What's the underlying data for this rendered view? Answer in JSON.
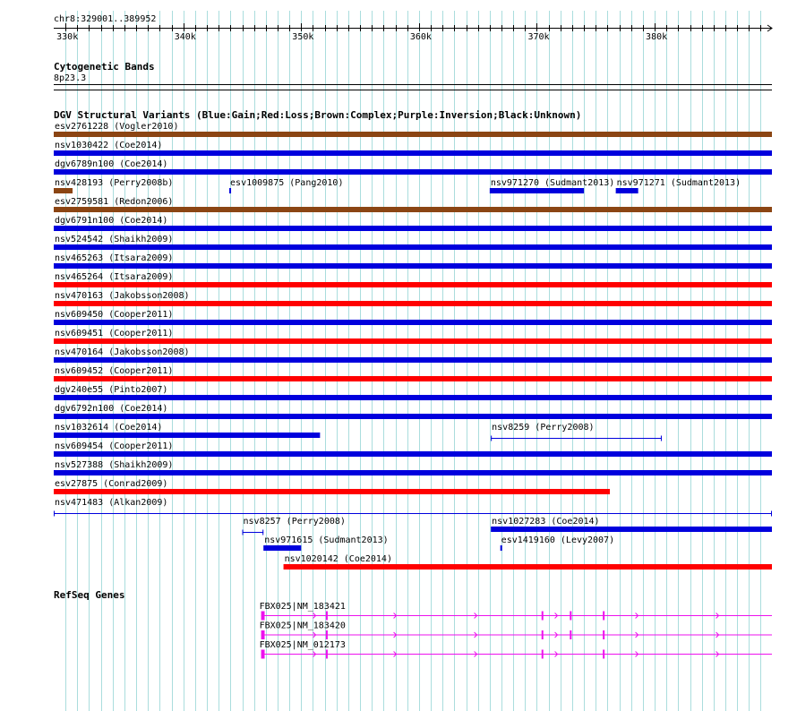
{
  "region": "chr8:329001..389952",
  "axis": {
    "ticks": [
      {
        "pos": 330000,
        "label": "330k"
      },
      {
        "pos": 340000,
        "label": "340k"
      },
      {
        "pos": 350000,
        "label": "350k"
      },
      {
        "pos": 360000,
        "label": "360k"
      },
      {
        "pos": 370000,
        "label": "370k"
      },
      {
        "pos": 380000,
        "label": "380k"
      }
    ],
    "start": 329001,
    "end": 389952
  },
  "colors": {
    "gain": "#0000dd",
    "loss": "#ff0000",
    "complex": "#8b4513",
    "gene": "#ee11ee",
    "grid": "#aadddd"
  },
  "tracks": {
    "cytoband": {
      "title": "Cytogenetic Bands",
      "band": "8p23.3"
    },
    "dgv": {
      "title": "DGV Structural Variants (Blue:Gain;Red:Loss;Brown:Complex;Purple:Inversion;Black:Unknown)",
      "rows": [
        [
          {
            "label": "esv2761228 (Vogler2010)",
            "start": 329001,
            "end": 389952,
            "type": "complex"
          }
        ],
        [
          {
            "label": "nsv1030422 (Coe2014)",
            "start": 329001,
            "end": 389952,
            "type": "gain"
          }
        ],
        [
          {
            "label": "dgv6789n100 (Coe2014)",
            "start": 329001,
            "end": 389952,
            "type": "gain"
          }
        ],
        [
          {
            "label": "nsv428193 (Perry2008b)",
            "start": 329001,
            "end": 330600,
            "type": "complex"
          },
          {
            "label": "esv1009875 (Pang2010)",
            "start": 343900,
            "end": 344000,
            "type": "gain"
          },
          {
            "label": "nsv971270 (Sudmant2013)",
            "start": 366000,
            "end": 374000,
            "type": "gain"
          },
          {
            "label": "nsv971271 (Sudmant2013)",
            "start": 376700,
            "end": 378600,
            "type": "gain"
          }
        ],
        [
          {
            "label": "esv2759581 (Redon2006)",
            "start": 329001,
            "end": 389952,
            "type": "complex"
          }
        ],
        [
          {
            "label": "dgv6791n100 (Coe2014)",
            "start": 329001,
            "end": 389952,
            "type": "gain"
          }
        ],
        [
          {
            "label": "nsv524542 (Shaikh2009)",
            "start": 329001,
            "end": 389952,
            "type": "gain"
          }
        ],
        [
          {
            "label": "nsv465263 (Itsara2009)",
            "start": 329001,
            "end": 389952,
            "type": "gain"
          }
        ],
        [
          {
            "label": "nsv465264 (Itsara2009)",
            "start": 329001,
            "end": 389952,
            "type": "loss"
          }
        ],
        [
          {
            "label": "nsv470163 (Jakobsson2008)",
            "start": 329001,
            "end": 389952,
            "type": "loss"
          }
        ],
        [
          {
            "label": "nsv609450 (Cooper2011)",
            "start": 329001,
            "end": 389952,
            "type": "gain"
          }
        ],
        [
          {
            "label": "nsv609451 (Cooper2011)",
            "start": 329001,
            "end": 389952,
            "type": "loss"
          }
        ],
        [
          {
            "label": "nsv470164 (Jakobsson2008)",
            "start": 329001,
            "end": 389952,
            "type": "gain"
          }
        ],
        [
          {
            "label": "nsv609452 (Cooper2011)",
            "start": 329001,
            "end": 389952,
            "type": "loss"
          }
        ],
        [
          {
            "label": "dgv240e55 (Pinto2007)",
            "start": 329001,
            "end": 389952,
            "type": "gain"
          }
        ],
        [
          {
            "label": "dgv6792n100 (Coe2014)",
            "start": 329001,
            "end": 389952,
            "type": "gain"
          }
        ],
        [
          {
            "label": "nsv1032614 (Coe2014)",
            "start": 329001,
            "end": 351600,
            "type": "gain"
          },
          {
            "label": "nsv8259 (Perry2008)",
            "start": 366100,
            "end": 380600,
            "type": "gain",
            "style": "thin"
          }
        ],
        [
          {
            "label": "nsv609454 (Cooper2011)",
            "start": 329001,
            "end": 389952,
            "type": "gain"
          }
        ],
        [
          {
            "label": "nsv527388 (Shaikh2009)",
            "start": 329001,
            "end": 389952,
            "type": "gain"
          }
        ],
        [
          {
            "label": "esv27875 (Conrad2009)",
            "start": 329001,
            "end": 376200,
            "type": "loss"
          }
        ],
        [
          {
            "label": "nsv471483 (Alkan2009)",
            "start": 329001,
            "end": 389952,
            "type": "gain",
            "style": "thin"
          }
        ],
        [
          {
            "label": "nsv8257 (Perry2008)",
            "start": 345000,
            "end": 346800,
            "type": "gain",
            "style": "thin"
          },
          {
            "label": "nsv1027283 (Coe2014)",
            "start": 366100,
            "end": 389952,
            "type": "gain"
          }
        ],
        [
          {
            "label": "nsv971615 (Sudmant2013)",
            "start": 346800,
            "end": 350000,
            "type": "gain"
          },
          {
            "label": "esv1419160 (Levy2007)",
            "start": 366900,
            "end": 367000,
            "type": "gain"
          }
        ],
        [
          {
            "label": "nsv1020142 (Coe2014)",
            "start": 348500,
            "end": 389952,
            "type": "loss"
          }
        ]
      ]
    },
    "refseq": {
      "title": "RefSeq Genes",
      "genes": [
        {
          "label": "FBX025|NM_183421",
          "start": 346600,
          "end": 389952,
          "exons": [
            [
              346600,
              346900
            ],
            [
              352100,
              352200
            ],
            [
              370400,
              370500
            ],
            [
              372800,
              372900
            ],
            [
              375600,
              375700
            ]
          ]
        },
        {
          "label": "FBX025|NM_183420",
          "start": 346600,
          "end": 389952,
          "exons": [
            [
              346600,
              346900
            ],
            [
              352100,
              352200
            ],
            [
              370400,
              370500
            ],
            [
              372800,
              372900
            ],
            [
              375600,
              375700
            ]
          ]
        },
        {
          "label": "FBX025|NM_012173",
          "start": 346600,
          "end": 389952,
          "exons": [
            [
              346600,
              346900
            ],
            [
              352100,
              352200
            ],
            [
              370400,
              370500
            ],
            [
              375600,
              375700
            ]
          ]
        }
      ]
    }
  }
}
